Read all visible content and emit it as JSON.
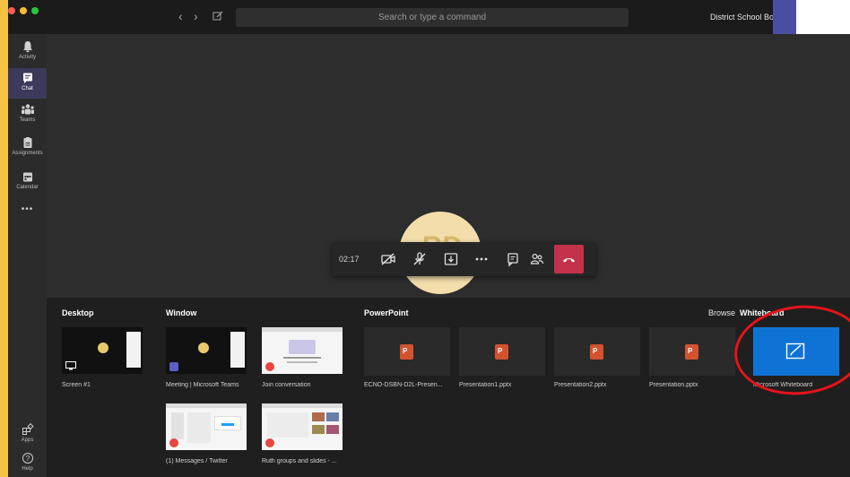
{
  "titlebar": {
    "search_placeholder": "Search or type a command",
    "organization": "District School Boar",
    "back_icon": "chevron-left",
    "forward_icon": "chevron-right",
    "compose_icon": "compose"
  },
  "rail": {
    "items": [
      {
        "label": "Activity",
        "icon": "bell-icon"
      },
      {
        "label": "Chat",
        "icon": "chat-icon",
        "active": true
      },
      {
        "label": "Teams",
        "icon": "teams-icon"
      },
      {
        "label": "Assignments",
        "icon": "assignments-icon"
      },
      {
        "label": "Calendar",
        "icon": "calendar-icon"
      }
    ],
    "more_label": "•••",
    "apps_label": "Apps",
    "help_label": "Help"
  },
  "call": {
    "avatar_initials": "RD",
    "timer": "02:17"
  },
  "share": {
    "desktop_title": "Desktop",
    "window_title": "Window",
    "powerpoint_title": "PowerPoint",
    "browse_label": "Browse",
    "whiteboard_title": "Whiteboard",
    "desktop_items": [
      {
        "label": "Screen #1"
      }
    ],
    "window_items": [
      {
        "label": "Meeting | Microsoft Teams"
      },
      {
        "label": "Join conversation"
      },
      {
        "label": "(1) Messages / Twitter"
      },
      {
        "label": "Ruth groups and slides - ..."
      }
    ],
    "powerpoint_items": [
      {
        "label": "ECNO-DSBN-D2L-Presen..."
      },
      {
        "label": "Presentation1.pptx"
      },
      {
        "label": "Presentation2.pptx"
      },
      {
        "label": "Presentation.pptx"
      }
    ],
    "whiteboard_label": "Microsoft Whiteboard"
  },
  "colors": {
    "accent": "#4a4ea3",
    "hangup": "#c4314b",
    "whiteboard": "#0f73d6",
    "annotation": "#e5131b",
    "background_border": "#f6c244"
  }
}
